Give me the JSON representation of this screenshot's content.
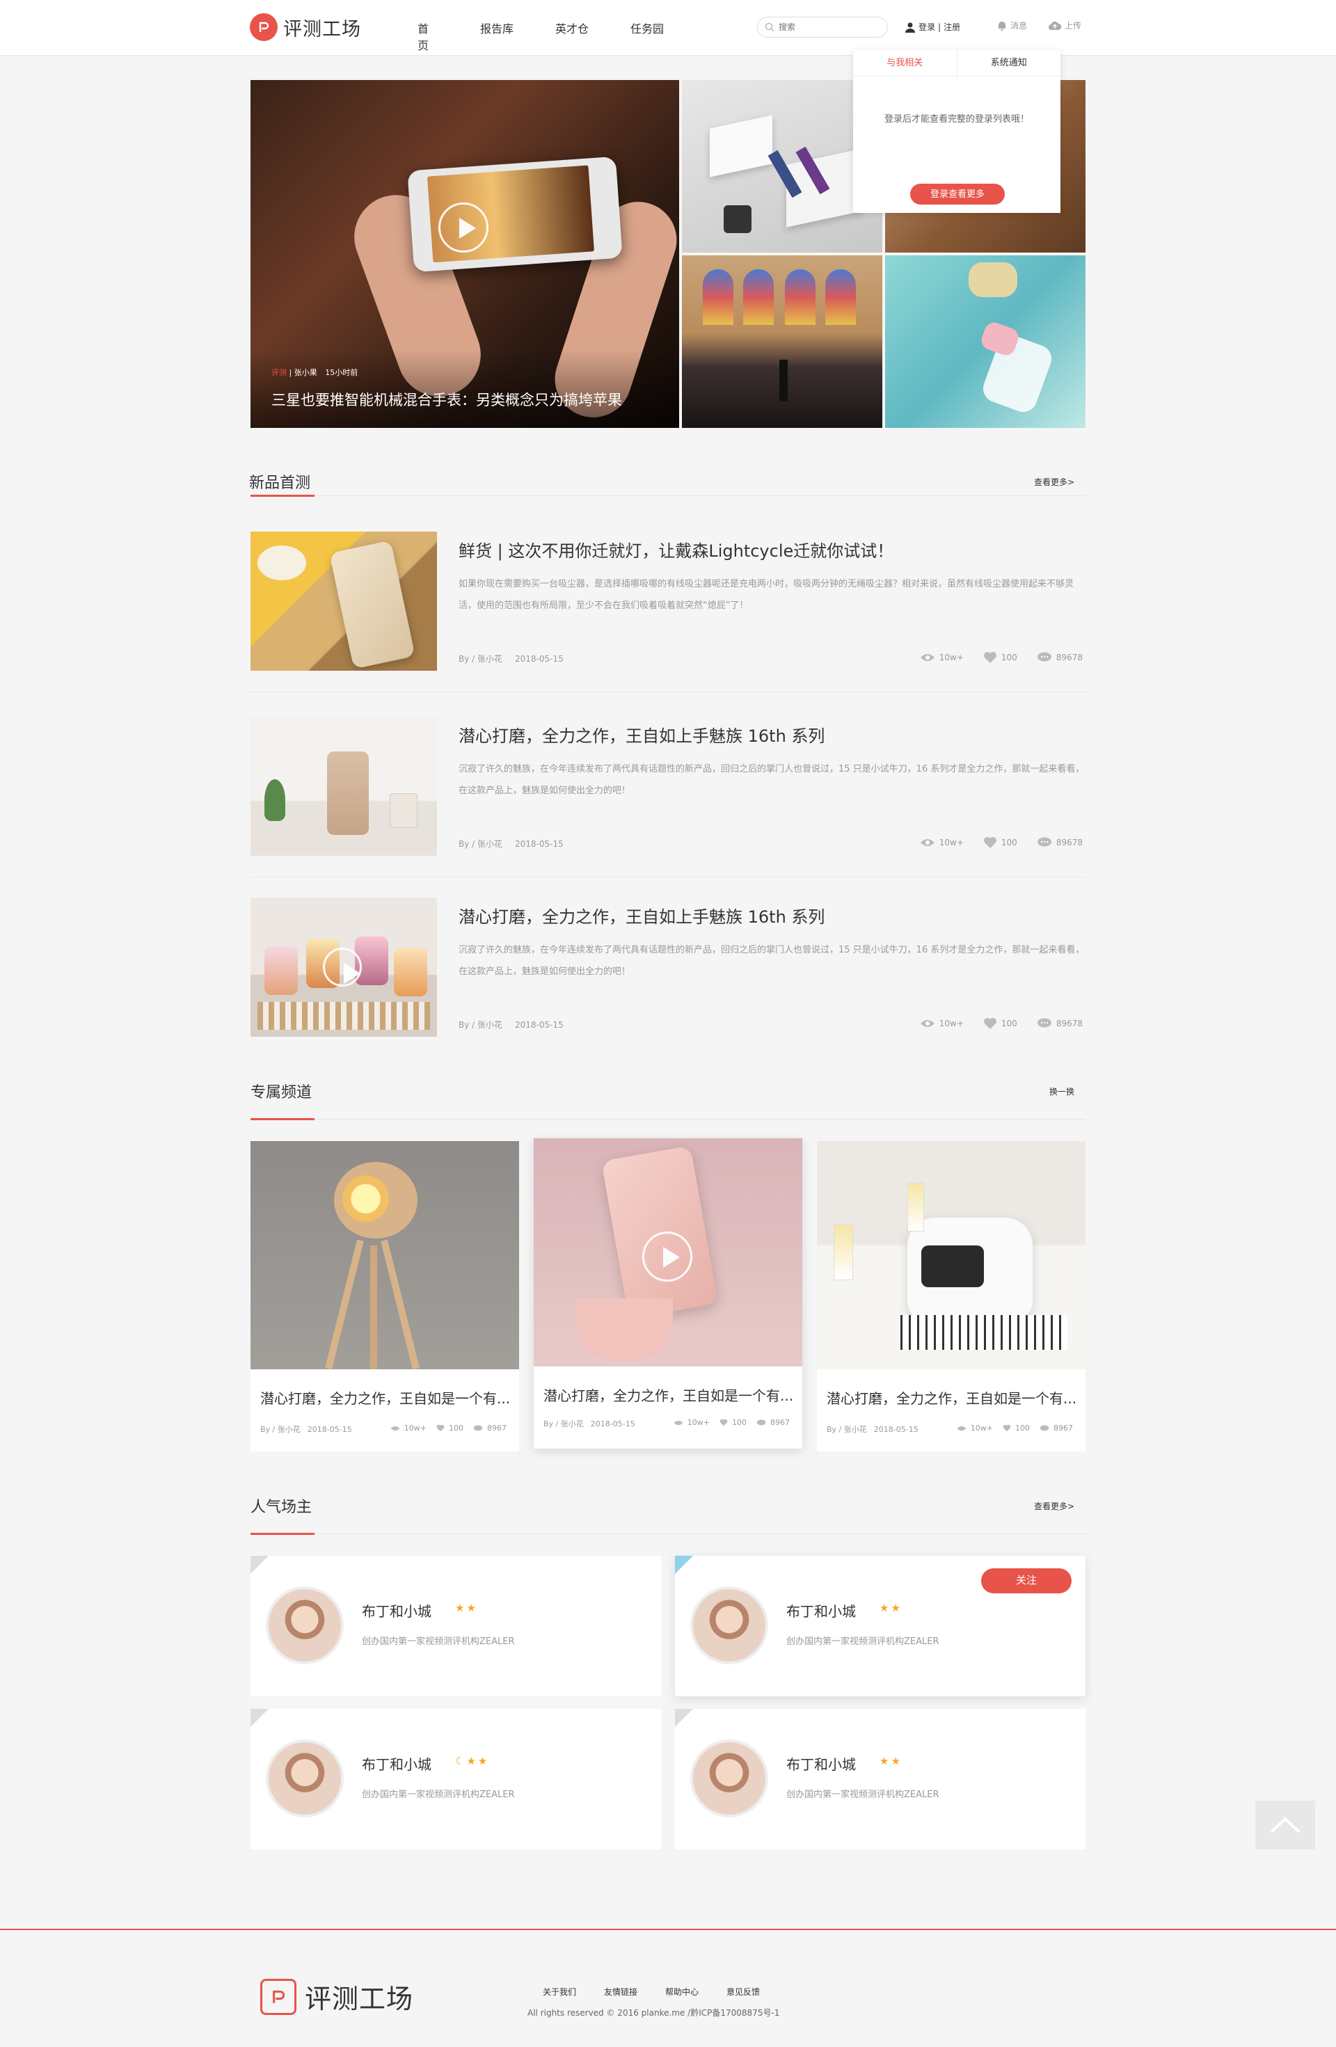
{
  "header": {
    "logo_text": "评测工场",
    "nav": [
      "首页",
      "报告库",
      "英才仓",
      "任务园"
    ],
    "search_placeholder": "搜索",
    "login_label": "登录",
    "register_label": "注册",
    "messages_label": "消息",
    "upload_label": "上传"
  },
  "popup": {
    "tabs": [
      "与我相关",
      "系统通知"
    ],
    "message": "登录后才能查看完整的登录列表哦！",
    "button": "登录查看更多"
  },
  "hero": {
    "tag": "评测",
    "author": "张小果",
    "time": "15小时前",
    "title": "三星也要推智能机械混合手表：另类概念只为搞垮苹果"
  },
  "new_products": {
    "title": "新品首测",
    "more": "查看更多>",
    "articles": [
      {
        "title": "鲜货 | 这次不用你迁就灯，让戴森Lightcycle迁就你试试！",
        "desc": "如果你现在需要购买一台吸尘器，是选择插哪吸哪的有线吸尘器呢还是充电两小时，吸吸两分钟的无绳吸尘器？相对来说，虽然有线吸尘器使用起来不够灵活，使用的范围也有所局限，至少不会在我们吸着吸着就突然“熄屁”了！",
        "by": "By / 张小花",
        "date": "2018-05-15",
        "views": "10w+",
        "likes": "100",
        "comments": "89678"
      },
      {
        "title": "潜心打磨，全力之作，王自如上手魅族 16th 系列",
        "desc": "沉寂了许久的魅族，在今年连续发布了两代具有话题性的新产品，回归之后的掌门人也曾说过，15 只是小试牛刀，16 系列才是全力之作，那就一起来看看，在这款产品上，魅族是如何使出全力的吧！",
        "by": "By / 张小花",
        "date": "2018-05-15",
        "views": "10w+",
        "likes": "100",
        "comments": "89678"
      },
      {
        "title": "潜心打磨，全力之作，王自如上手魅族 16th 系列",
        "desc": "沉寂了许久的魅族，在今年连续发布了两代具有话题性的新产品，回归之后的掌门人也曾说过，15 只是小试牛刀，16 系列才是全力之作，那就一起来看看，在这款产品上，魅族是如何使出全力的吧！",
        "by": "By / 张小花",
        "date": "2018-05-15",
        "views": "10w+",
        "likes": "100",
        "comments": "89678"
      }
    ]
  },
  "channels": {
    "title": "专属频道",
    "more": "换一换",
    "cards": [
      {
        "title": "潜心打磨，全力之作，王自如是一个有...",
        "by": "By / 张小花",
        "date": "2018-05-15",
        "views": "10w+",
        "likes": "100",
        "comments": "8967"
      },
      {
        "title": "潜心打磨，全力之作，王自如是一个有...",
        "by": "By / 张小花",
        "date": "2018-05-15",
        "views": "10w+",
        "likes": "100",
        "comments": "8967"
      },
      {
        "title": "潜心打磨，全力之作，王自如是一个有...",
        "by": "By / 张小花",
        "date": "2018-05-15",
        "views": "10w+",
        "likes": "100",
        "comments": "8967"
      }
    ]
  },
  "hosts": {
    "title": "人气场主",
    "more": "查看更多>",
    "follow_label": "关注",
    "items": [
      {
        "name": "布丁和小城",
        "stars": "★★",
        "desc": "创办国内第一家视频测评机构ZEALER"
      },
      {
        "name": "布丁和小城",
        "stars": "★★",
        "desc": "创办国内第一家视频测评机构ZEALER"
      },
      {
        "name": "布丁和小城",
        "stars": "☾★★",
        "desc": "创办国内第一家视频测评机构ZEALER"
      },
      {
        "name": "布丁和小城",
        "stars": "★★",
        "desc": "创办国内第一家视频测评机构ZEALER"
      }
    ]
  },
  "footer": {
    "logo_text": "评测工场",
    "links": [
      "关于我们",
      "友情链接",
      "帮助中心",
      "意见反馈"
    ],
    "copyright": "All rights reserved © 2016 planke.me /黔ICP备17008875号-1"
  },
  "colors": {
    "accent": "#e8534a",
    "star": "#f5a623"
  }
}
